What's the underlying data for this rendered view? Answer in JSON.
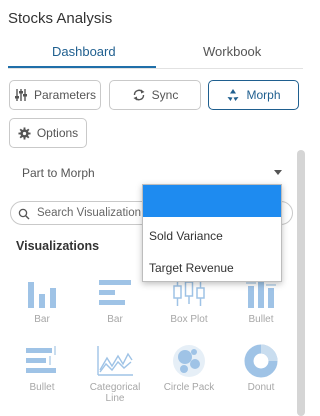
{
  "app": {
    "title": "Stocks Analysis"
  },
  "tabs": [
    {
      "label": "Dashboard",
      "active": true
    },
    {
      "label": "Workbook",
      "active": false
    }
  ],
  "toolbar": {
    "parameters_label": "Parameters",
    "sync_label": "Sync",
    "morph_label": "Morph",
    "options_label": "Options"
  },
  "part_select": {
    "value": "Part to Morph"
  },
  "search": {
    "placeholder": "Search Visualization"
  },
  "section": {
    "title": "Visualizations"
  },
  "visualizations": [
    {
      "label": "Bar",
      "icon": "bar-chart-icon"
    },
    {
      "label": "Bar",
      "icon": "horizontal-bar-icon"
    },
    {
      "label": "Box Plot",
      "icon": "box-plot-icon"
    },
    {
      "label": "Bullet",
      "icon": "bullet-icon"
    },
    {
      "label": "Bullet",
      "icon": "horizontal-bullet-icon"
    },
    {
      "label": "Categorical Line",
      "icon": "categorical-line-icon"
    },
    {
      "label": "Circle Pack",
      "icon": "circle-pack-icon"
    },
    {
      "label": "Donut",
      "icon": "donut-icon"
    }
  ],
  "dropdown": {
    "items": [
      {
        "label": ""
      },
      {
        "label": "Sold Variance"
      },
      {
        "label": "Target Revenue"
      }
    ]
  },
  "colors": {
    "accent": "#1f5f8f",
    "highlight": "#1e8bf0",
    "icon_muted": "#9fc3e6"
  }
}
